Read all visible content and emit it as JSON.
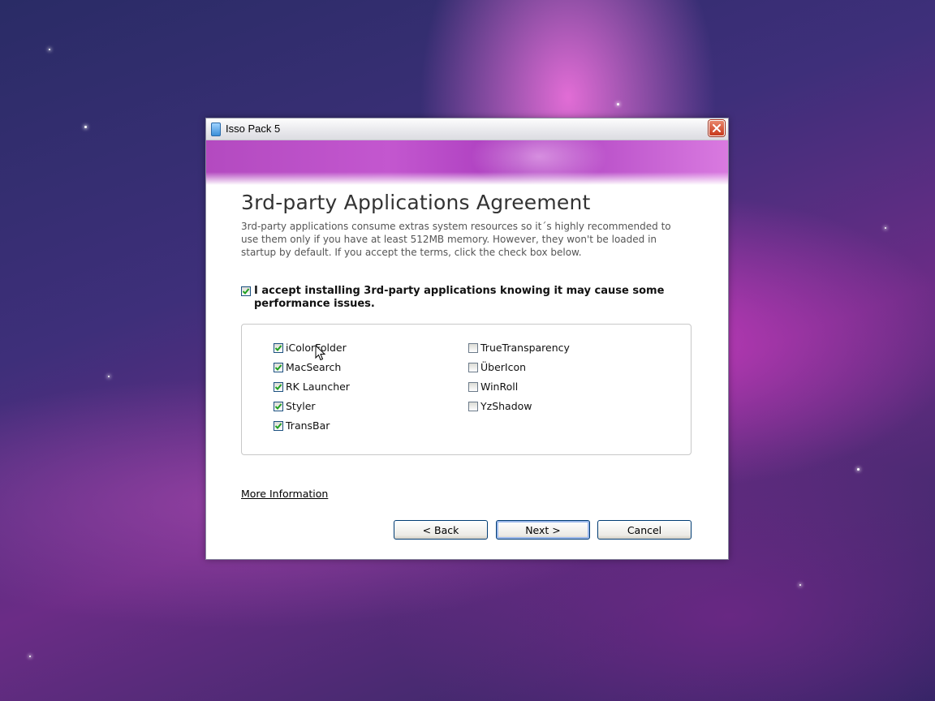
{
  "window": {
    "title": "Isso Pack 5"
  },
  "page": {
    "heading": "3rd-party Applications Agreement",
    "description": "3rd-party applications consume extras system resources so it´s highly recommended to use them only if you have at least 512MB memory. However, they won't be loaded in startup by default. If you accept the terms, click the check box below.",
    "accept_label": "I accept installing 3rd-party applications knowing it may cause some performance issues.",
    "accept_checked": true,
    "apps_left": [
      {
        "label": "iColorFolder",
        "checked": true
      },
      {
        "label": "MacSearch",
        "checked": true
      },
      {
        "label": "RK Launcher",
        "checked": true
      },
      {
        "label": "Styler",
        "checked": true
      },
      {
        "label": "TransBar",
        "checked": true
      }
    ],
    "apps_right": [
      {
        "label": "TrueTransparency",
        "checked": false
      },
      {
        "label": "ÜberIcon",
        "checked": false
      },
      {
        "label": "WinRoll",
        "checked": false
      },
      {
        "label": "YzShadow",
        "checked": false
      }
    ],
    "more_info": "More Information"
  },
  "buttons": {
    "back": "< Back",
    "next": "Next >",
    "cancel": "Cancel"
  },
  "colors": {
    "banner": "#c357cf",
    "check": "#21a121",
    "close": "#c8391c"
  }
}
